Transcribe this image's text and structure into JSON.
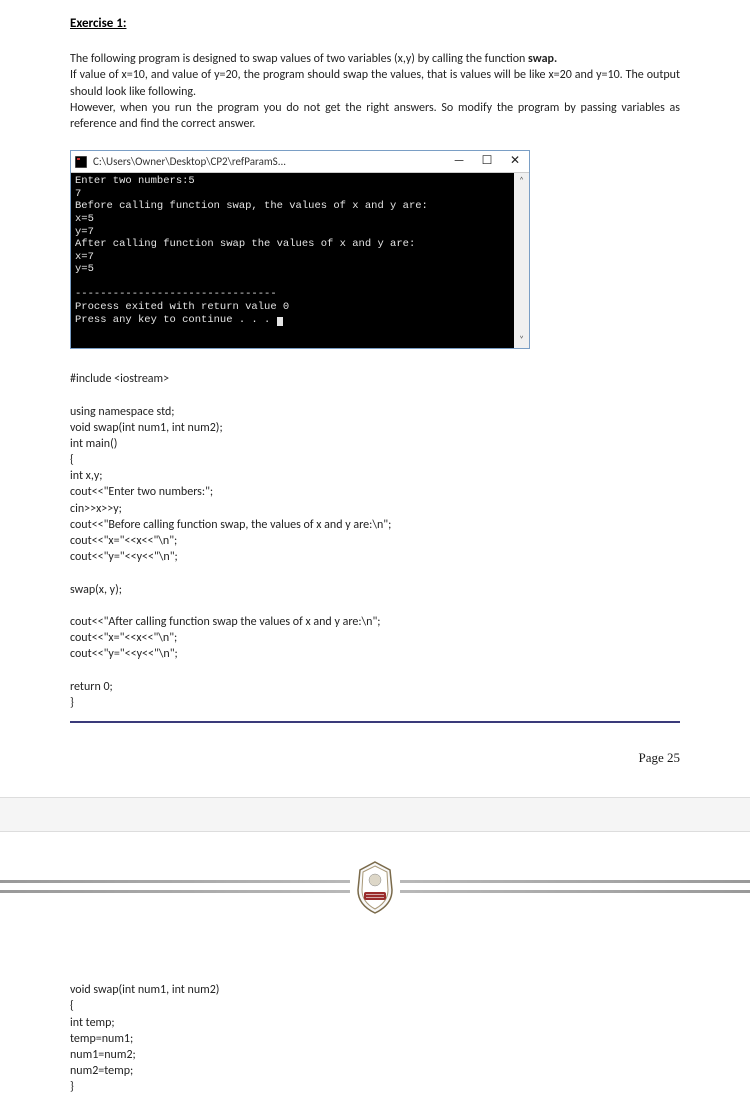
{
  "exercise_title": "Exercise 1:",
  "description_p1_a": "The following program is designed to swap values of two variables (x,y) by calling the function ",
  "description_p1_b": "swap.",
  "description_p2": "If value of x=10, and value of y=20, the program should swap the values, that is values will be like x=20 and y=10. The output should look like following.",
  "description_p3": "However, when you run the program you do not get the right answers. So modify the program by passing variables as reference and find the correct answer.",
  "console": {
    "title": "C:\\Users\\Owner\\Desktop\\CP2\\refParamS...",
    "minimize": "—",
    "maximize": "☐",
    "close": "✕",
    "lines": {
      "l0": "Enter two numbers:5",
      "l1": "7",
      "l2": "Before calling function swap, the values of x and y are:",
      "l3": "x=5",
      "l4": "y=7",
      "l5": "After calling function swap the values of x and y are:",
      "l6": "x=7",
      "l7": "y=5",
      "l8": "",
      "l9": "--------------------------------",
      "l10": "Process exited with return value 0",
      "l11": "Press any key to continue . . . "
    },
    "scroll_up": "˄",
    "scroll_down": "˅"
  },
  "code_main": {
    "l0": "#include <iostream>",
    "blank0": "",
    "l1": "using namespace std;",
    "l2": "void swap(int num1, int num2);",
    "l3": "int main()",
    "l4": "{",
    "l5": "int x,y;",
    "l6": "cout<<\"Enter two numbers:\";",
    "l7": "cin>>x>>y;",
    "l8": "cout<<\"Before calling function swap, the values of x and y are:\\n\";",
    "l9": "cout<<\"x=\"<<x<<\"\\n\";",
    "l10": "cout<<\"y=\"<<y<<\"\\n\";",
    "blank1": "",
    "l11": "swap(x, y);",
    "blank2": "",
    "l12": "cout<<\"After calling function swap the values of x and y are:\\n\";",
    "l13": "cout<<\"x=\"<<x<<\"\\n\";",
    "l14": "cout<<\"y=\"<<y<<\"\\n\";",
    "blank3": "",
    "l15": "return 0;",
    "l16": "}"
  },
  "page_number": "Page 25",
  "code_swap": {
    "l0": "void swap(int num1, int num2)",
    "l1": "{",
    "l2": "int temp;",
    "l3": "temp=num1;",
    "l4": "num1=num2;",
    "l5": "num2=temp;",
    "l6": "}"
  }
}
